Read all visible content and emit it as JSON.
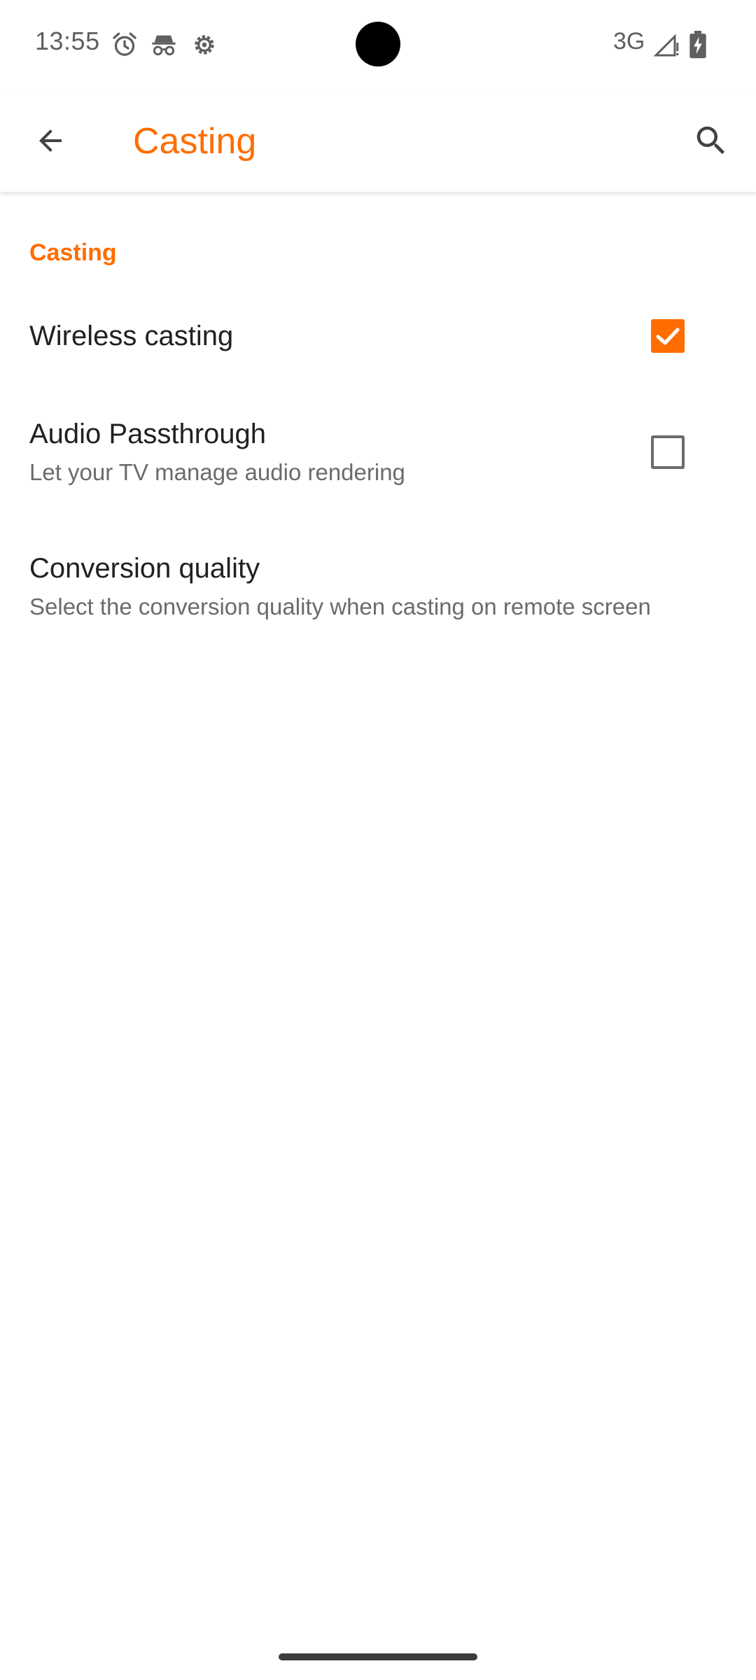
{
  "status_bar": {
    "time": "13:55",
    "network": "3G",
    "icons": [
      "alarm-icon",
      "incognito-icon",
      "settings-gear-icon",
      "signal-icon",
      "battery-charging-icon"
    ]
  },
  "app_bar": {
    "title": "Casting",
    "back_icon": "arrow-back-icon",
    "search_icon": "search-icon"
  },
  "section": {
    "title": "Casting"
  },
  "preferences": [
    {
      "title": "Wireless casting",
      "summary": "",
      "checked": true
    },
    {
      "title": "Audio Passthrough",
      "summary": "Let your TV manage audio rendering",
      "checked": false
    },
    {
      "title": "Conversion quality",
      "summary": "Select the conversion quality when casting on remote screen"
    }
  ],
  "colors": {
    "accent": "#ff6d00",
    "text_primary": "#212121",
    "text_secondary": "#6b6b6b"
  }
}
